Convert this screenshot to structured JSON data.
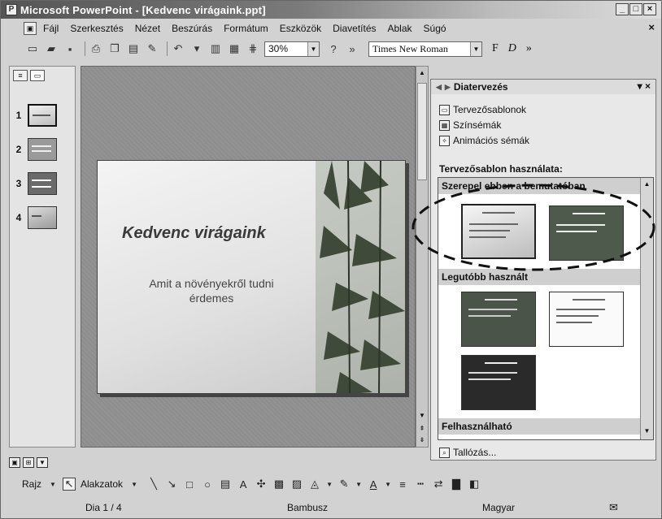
{
  "window": {
    "title": "Microsoft PowerPoint - [Kedvenc virágaink.ppt]",
    "buttons": [
      "_",
      "□",
      "×"
    ]
  },
  "menu": {
    "items": [
      "Fájl",
      "Szerkesztés",
      "Nézet",
      "Beszúrás",
      "Formátum",
      "Eszközök",
      "Diavetítés",
      "Ablak",
      "Súgó"
    ],
    "close": "×"
  },
  "toolbar": {
    "zoom": "30%",
    "font": "Times New Roman",
    "more": "»",
    "bold": "F",
    "italic": "D"
  },
  "slides_pane": {
    "numbers": [
      "1",
      "2",
      "3",
      "4"
    ]
  },
  "slide": {
    "title": "Kedvenc virágaink",
    "subtitle": "Amit a növényekről tudni érdemes"
  },
  "task_pane": {
    "title": "Diatervezés",
    "links": [
      "Tervezősablonok",
      "Színsémák",
      "Animációs sémák"
    ],
    "section_label": "Tervezősablon használata:",
    "groups": [
      "Szerepel ebben a bemutatóban",
      "Legutóbb használt",
      "Felhasználható"
    ],
    "browse": "Tallózás..."
  },
  "drawing": {
    "draw": "Rajz",
    "shapes": "Alakzatok"
  },
  "status": {
    "slide": "Dia 1 / 4",
    "template": "Bambusz",
    "language": "Magyar"
  }
}
